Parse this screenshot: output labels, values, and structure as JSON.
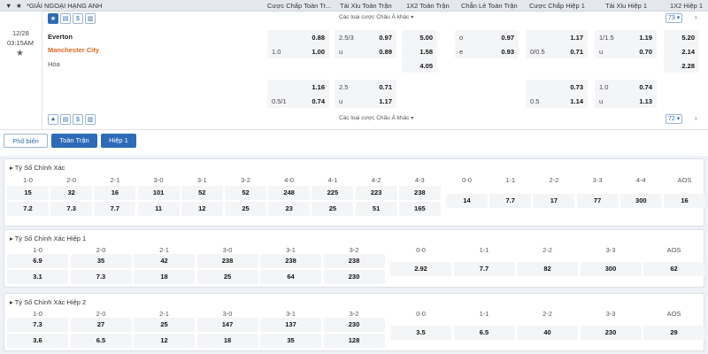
{
  "header": {
    "league": "*GIẢI NGOẠI HẠNG ANH",
    "columns": [
      "Cược Chấp Toàn Tr...",
      "Tài Xỉu Toàn Trận",
      "1X2 Toàn Trận",
      "Chẵn Lẻ Toàn Trận",
      "Cược Chấp Hiệp 1",
      "Tài Xỉu Hiệp 1",
      "1X2 Hiệp 1"
    ]
  },
  "match": {
    "date": "12/28",
    "time": "03:15AM",
    "home": "Everton",
    "away": "Manchester City",
    "draw": "Hòa",
    "more_top": "Các loại cược Châu Á khác",
    "count_top": "73",
    "more_bottom": "Các loại cược Châu Á khác",
    "count_bottom": "72",
    "rows1": {
      "hdp_ft": [
        {
          "l": "",
          "v": "0.88"
        },
        {
          "l": "1.0",
          "v": "1.00"
        }
      ],
      "ou_ft": [
        {
          "l": "2.5/3",
          "v": "0.97"
        },
        {
          "l": "u",
          "v": "0.89"
        }
      ],
      "x12_ft": [
        "5.00",
        "1.58",
        "4.05"
      ],
      "oe_ft": [
        {
          "l": "o",
          "v": "0.97"
        },
        {
          "l": "e",
          "v": "0.93"
        }
      ],
      "hdp_h1": [
        {
          "l": "",
          "v": "1.17"
        },
        {
          "l": "0/0.5",
          "v": "0.71"
        }
      ],
      "ou_h1": [
        {
          "l": "1/1.5",
          "v": "1.19"
        },
        {
          "l": "u",
          "v": "0.70"
        }
      ],
      "x12_h1": [
        "5.20",
        "2.14",
        "2.28"
      ]
    },
    "rows2": {
      "hdp_ft": [
        {
          "l": "",
          "v": "1.16"
        },
        {
          "l": "0.5/1",
          "v": "0.74"
        }
      ],
      "ou_ft": [
        {
          "l": "2.5",
          "v": "0.71"
        },
        {
          "l": "u",
          "v": "1.17"
        }
      ],
      "hdp_h1": [
        {
          "l": "",
          "v": "0.73"
        },
        {
          "l": "0.5",
          "v": "1.14"
        }
      ],
      "ou_h1": [
        {
          "l": "1.0",
          "v": "0.74"
        },
        {
          "l": "u",
          "v": "1.13"
        }
      ]
    }
  },
  "tabs": [
    "Phổ biến",
    "Toàn Trận",
    "Hiệp 1"
  ],
  "sections": {
    "cs_ft": {
      "title": "Tỷ Số Chính Xác",
      "home_headers": [
        "1-0",
        "2-0",
        "2-1",
        "3-0",
        "3-1",
        "3-2",
        "4-0",
        "4-1",
        "4-2",
        "4-3"
      ],
      "home_row1": [
        "15",
        "32",
        "16",
        "101",
        "52",
        "52",
        "248",
        "225",
        "223",
        "238"
      ],
      "home_row2": [
        "7.2",
        "7.3",
        "7.7",
        "11",
        "12",
        "25",
        "23",
        "25",
        "51",
        "165"
      ],
      "draw_headers": [
        "0-0",
        "1-1",
        "2-2",
        "3-3",
        "4-4",
        "AOS"
      ],
      "draw_values": [
        "14",
        "7.7",
        "17",
        "77",
        "300",
        "16"
      ]
    },
    "cs_h1": {
      "title": "Tỷ Số Chính Xác Hiệp 1",
      "home_headers": [
        "1-0",
        "2-0",
        "2-1",
        "3-0",
        "3-1",
        "3-2"
      ],
      "home_row1": [
        "6.9",
        "35",
        "42",
        "238",
        "238",
        "238"
      ],
      "home_row2": [
        "3.1",
        "7.3",
        "18",
        "25",
        "64",
        "230"
      ],
      "draw_headers": [
        "0-0",
        "1-1",
        "2-2",
        "3-3",
        "AOS"
      ],
      "draw_values": [
        "2.92",
        "7.7",
        "82",
        "300",
        "62"
      ]
    },
    "cs_h2": {
      "title": "Tỷ Số Chính Xác Hiệp 2",
      "home_headers": [
        "1-0",
        "2-0",
        "2-1",
        "3-0",
        "3-1",
        "3-2"
      ],
      "home_row1": [
        "7.3",
        "27",
        "25",
        "147",
        "137",
        "230"
      ],
      "home_row2": [
        "3.6",
        "6.5",
        "12",
        "18",
        "35",
        "128"
      ],
      "draw_headers": [
        "0-0",
        "1-1",
        "2-2",
        "3-3",
        "AOS"
      ],
      "draw_values": [
        "3.5",
        "6.5",
        "40",
        "230",
        "29"
      ]
    }
  }
}
